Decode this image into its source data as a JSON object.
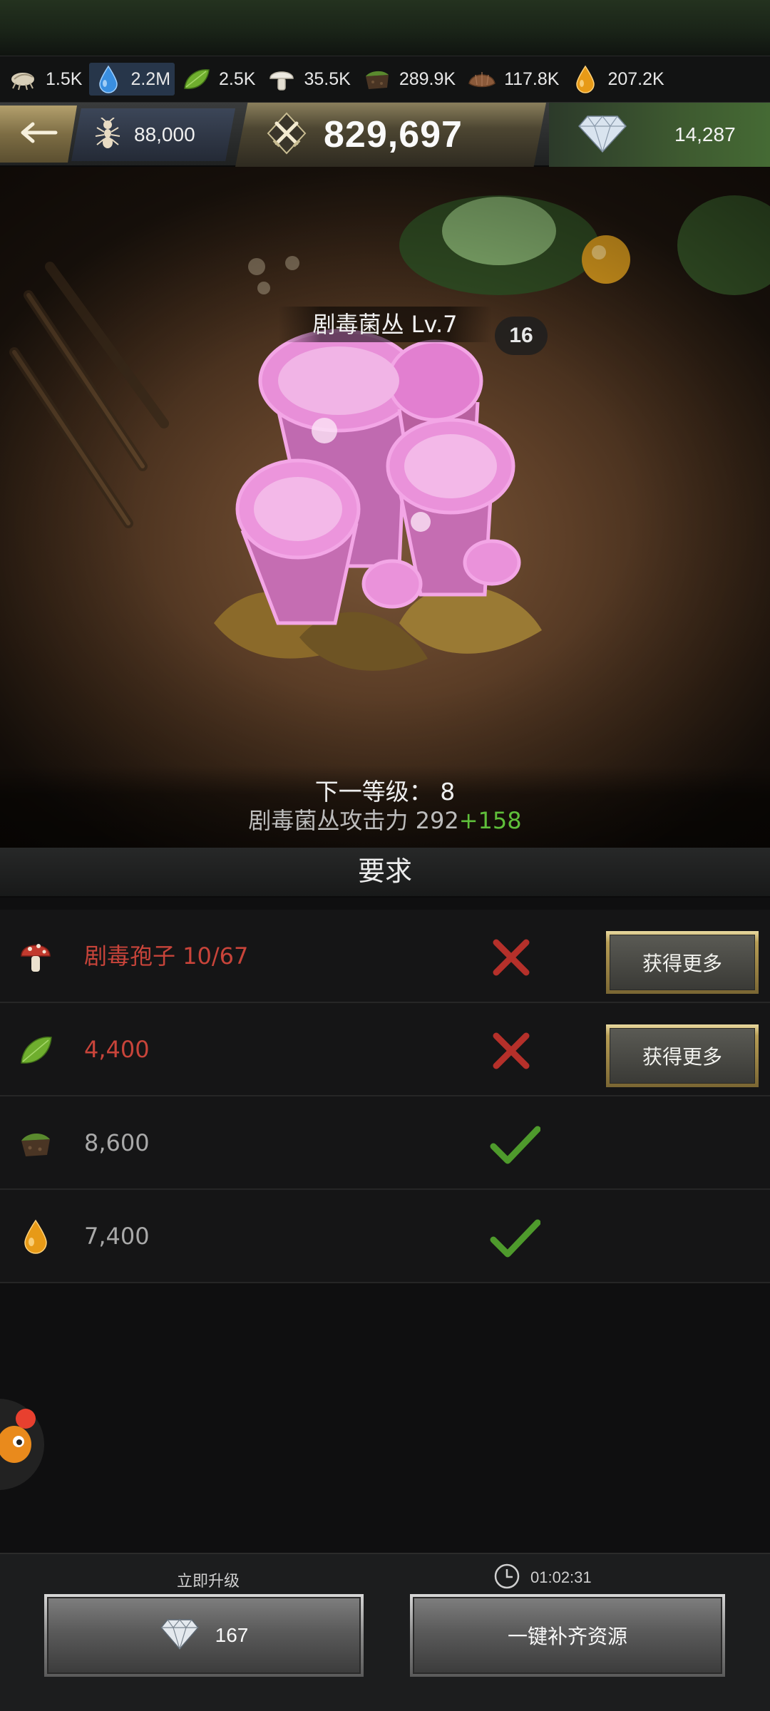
{
  "resources": [
    {
      "icon": "larva-icon",
      "value": "1.5K"
    },
    {
      "icon": "water-drop-icon",
      "value": "2.2M",
      "highlight": true
    },
    {
      "icon": "leaf-icon",
      "value": "2.5K"
    },
    {
      "icon": "mushroom-icon",
      "value": "35.5K"
    },
    {
      "icon": "soil-icon",
      "value": "289.9K"
    },
    {
      "icon": "seed-icon",
      "value": "117.8K"
    },
    {
      "icon": "honeydew-icon",
      "value": "207.2K"
    }
  ],
  "header": {
    "ant_count": "88,000",
    "power": "829,697",
    "gems": "14,287"
  },
  "building": {
    "name": "剧毒菌丛  Lv.7",
    "badge": "16",
    "next_level_text": "下一等级： 8",
    "attack_text": "剧毒菌丛攻击力 292",
    "attack_bonus": "+158"
  },
  "requirements": {
    "title": "要求",
    "items": [
      {
        "icon": "toadstool-icon",
        "label": "剧毒孢子 10/67",
        "met": false,
        "action": "获得更多"
      },
      {
        "icon": "leaf-icon",
        "label": "4,400",
        "met": false,
        "action": "获得更多"
      },
      {
        "icon": "soil-icon",
        "label": "8,600",
        "met": true
      },
      {
        "icon": "honeydew-icon",
        "label": "7,400",
        "met": true
      }
    ]
  },
  "bottom": {
    "instant_label": "立即升级",
    "instant_cost": "167",
    "timer": "01:02:31",
    "fill_label": "一键补齐资源"
  },
  "colors": {
    "unmet": "#c8443a",
    "met": "#5fa832",
    "bonus": "#5fbf3a",
    "gold": "#b79d55"
  }
}
